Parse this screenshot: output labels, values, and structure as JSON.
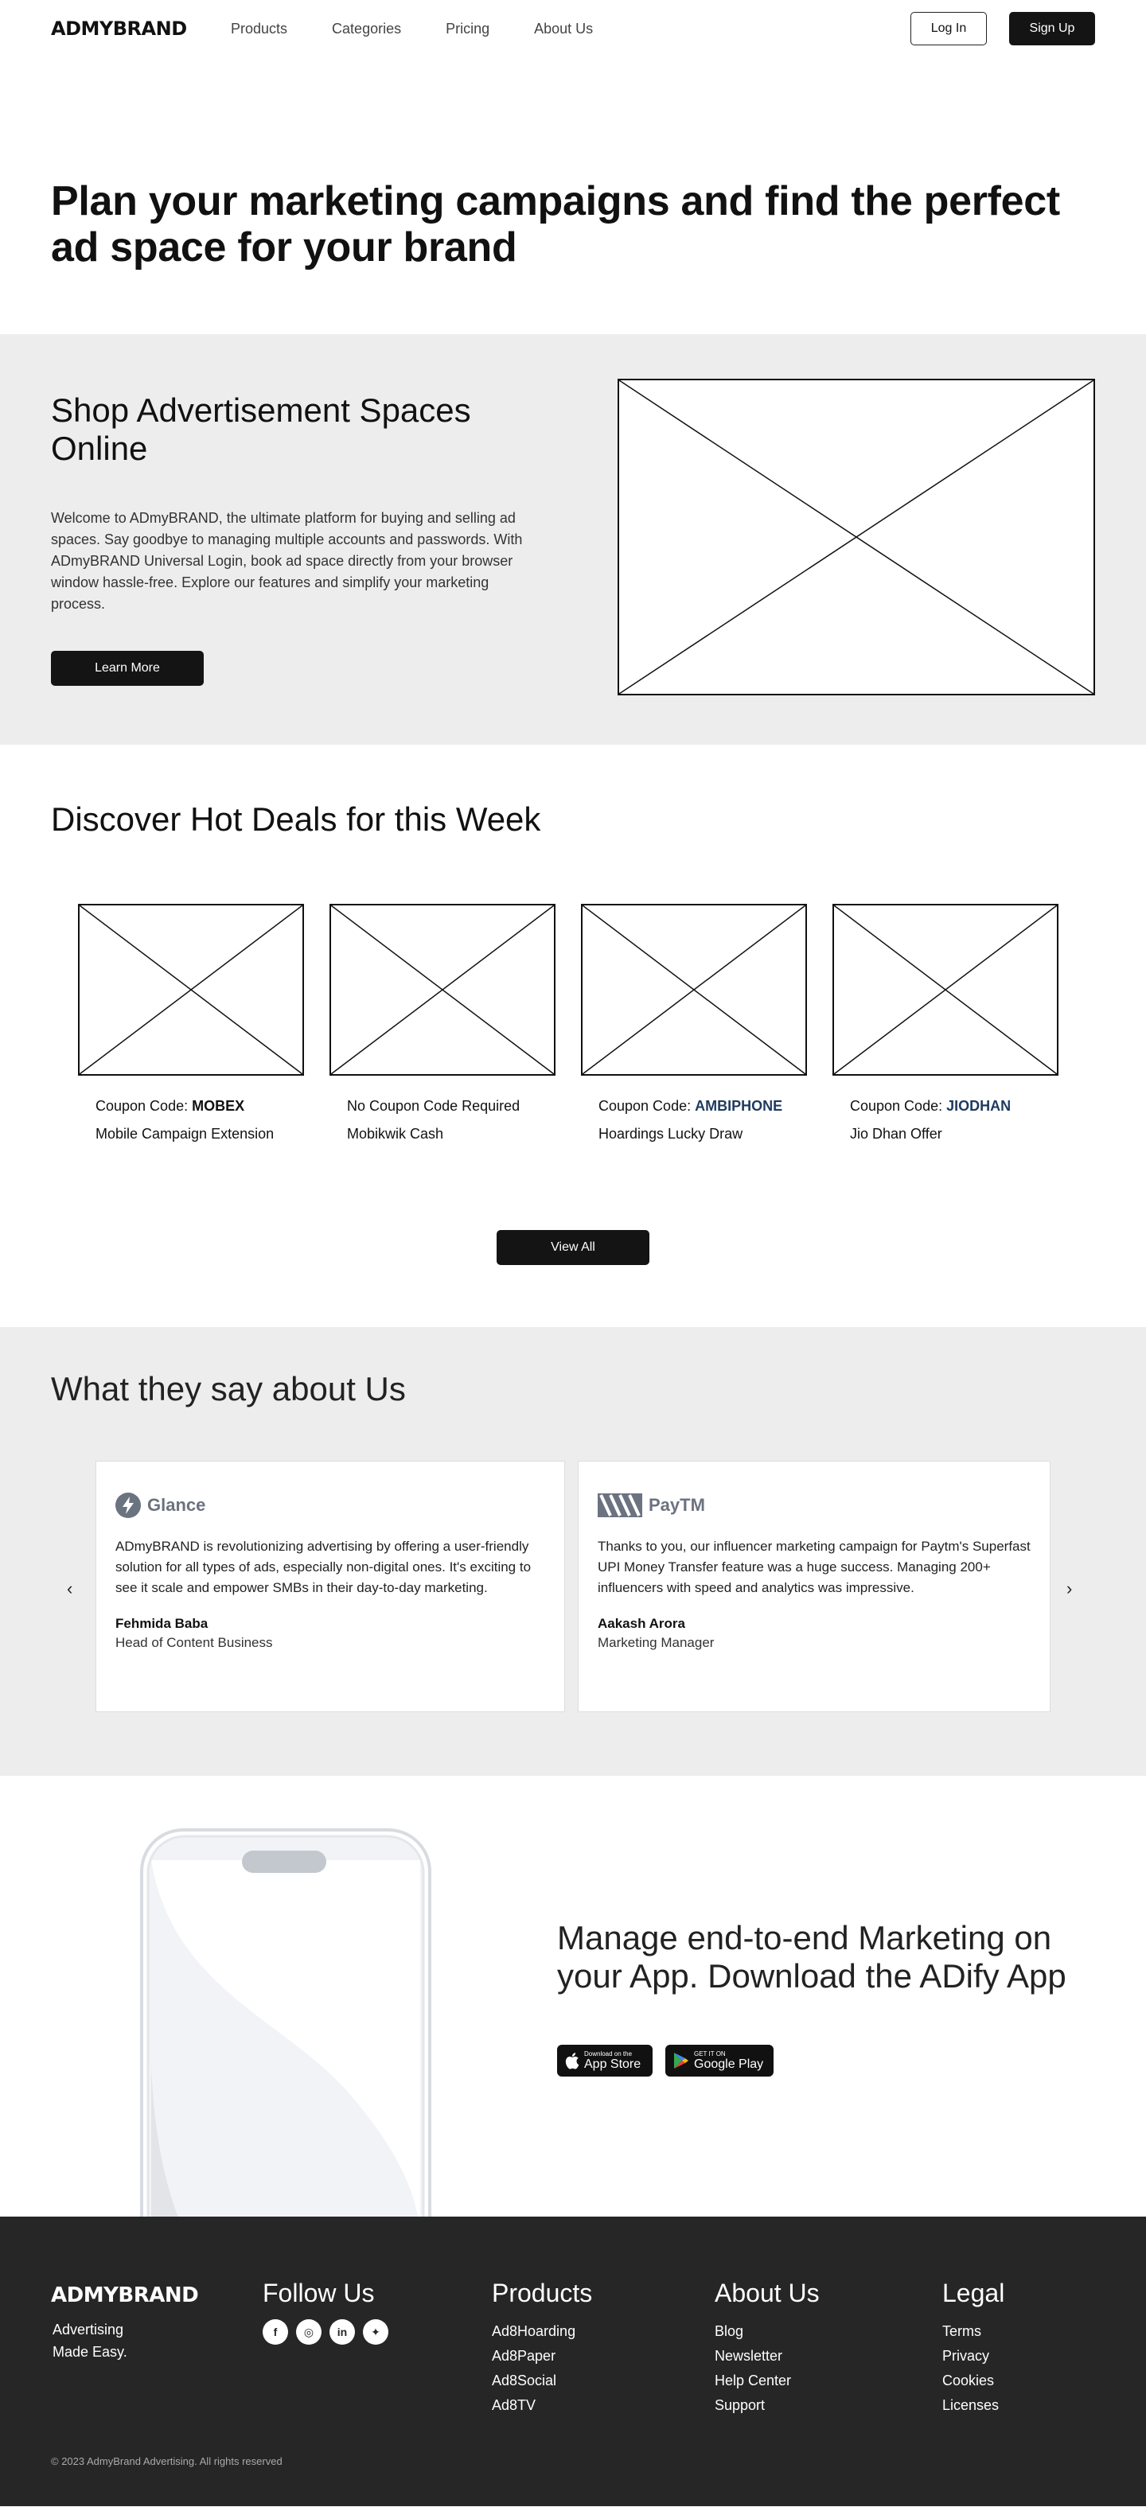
{
  "nav": {
    "logo": "ADMYBRAND",
    "links": [
      "Products",
      "Categories",
      "Pricing",
      "About Us"
    ],
    "login": "Log In",
    "signup": "Sign Up"
  },
  "hero": {
    "title": "Plan your marketing campaigns and find the perfect ad space for your brand"
  },
  "shop": {
    "title": "Shop Advertisement Spaces Online",
    "text": "Welcome to ADmyBRAND, the ultimate platform for buying and selling ad spaces. Say goodbye to managing multiple accounts and passwords. With ADmyBRAND Universal Login, book ad space directly from your browser window hassle-free. Explore our features and simplify your marketing process.",
    "button": "Learn More"
  },
  "deals": {
    "title": "Discover Hot Deals for this Week",
    "items": [
      {
        "prefix": "Coupon Code: ",
        "code": "MOBEX",
        "title": "Mobile Campaign Extension"
      },
      {
        "prefix": "No Coupon Code Required",
        "code": "",
        "title": "Mobikwik Cash"
      },
      {
        "prefix": "Coupon Code: ",
        "code": "AMBIPHONE",
        "title": "Hoardings Lucky Draw"
      },
      {
        "prefix": "Coupon Code: ",
        "code": "JIODHAN",
        "title": "Jio Dhan Offer"
      }
    ],
    "button": "View All"
  },
  "testimonials": {
    "title": "What they say about Us",
    "prev": "‹",
    "next": "›",
    "items": [
      {
        "brand": "Glance",
        "quote": "ADmyBRAND is revolutionizing advertising by offering a user-friendly solution for all types of ads, especially non-digital ones. It's exciting to see it scale and empower SMBs in their day-to-day marketing.",
        "name": "Fehmida Baba",
        "role": "Head of Content Business"
      },
      {
        "brand": "PayTM",
        "quote": "Thanks to you, our influencer marketing campaign for Paytm's Superfast UPI Money Transfer feature was a huge success. Managing 200+ influencers with speed and analytics was impressive.",
        "name": "Aakash Arora",
        "role": "Marketing Manager"
      }
    ]
  },
  "app": {
    "title": "Manage end-to-end Marketing on your App. Download the ADify App",
    "appstore": {
      "small": "Download on the",
      "big": "App Store"
    },
    "playstore": {
      "small": "GET IT ON",
      "big": "Google Play"
    }
  },
  "footer": {
    "logo": "ADMYBRAND",
    "tagline": "Advertising Made Easy.",
    "follow": "Follow Us",
    "products": {
      "title": "Products",
      "items": [
        "Ad8Hoarding",
        "Ad8Paper",
        "Ad8Social",
        "Ad8TV"
      ]
    },
    "about": {
      "title": "About Us",
      "items": [
        "Blog",
        "Newsletter",
        "Help Center",
        "Support"
      ]
    },
    "legal": {
      "title": "Legal",
      "items": [
        "Terms",
        "Privacy",
        "Cookies",
        "Licenses"
      ]
    },
    "copyright": "© 2023 AdmyBrand Advertising. All rights reserved"
  }
}
